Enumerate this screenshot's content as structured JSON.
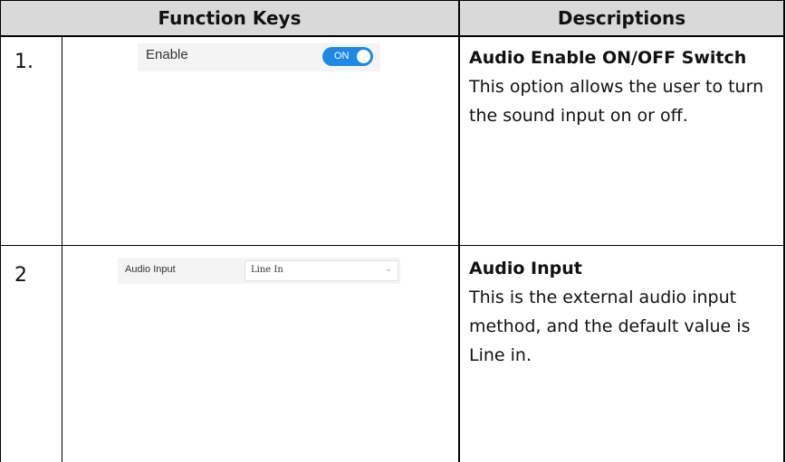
{
  "table": {
    "headers": {
      "function_keys": "Function Keys",
      "descriptions": "Descriptions"
    },
    "rows": [
      {
        "number": "1.",
        "widget": {
          "label": "Enable",
          "toggle_text": "ON"
        },
        "title": "Audio Enable ON/OFF Switch",
        "description": "This option allows the user to turn the sound input on or off."
      },
      {
        "number": "2",
        "widget": {
          "label": "Audio Input",
          "selected_value": "Line In",
          "dropdown_icon": "chevron-down-icon"
        },
        "title": "Audio Input",
        "description": "This is the external audio input method, and the default value is Line in."
      }
    ]
  },
  "colors": {
    "header_bg": "#d9d9d9",
    "toggle_on": "#1e88e5",
    "widget_bg": "#f4f4f4"
  }
}
